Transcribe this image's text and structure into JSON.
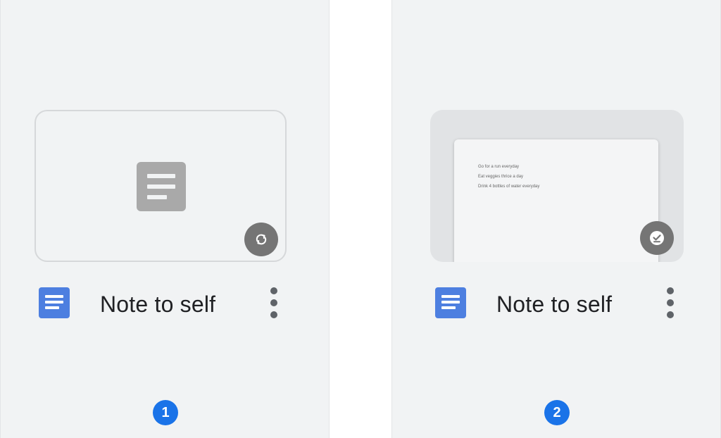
{
  "colors": {
    "panel_background": "#f1f3f4",
    "doc_icon_blue": "#4d7fe0",
    "status_badge_gray": "#757575",
    "step_marker_blue": "#1a73e8",
    "title_text": "#202124"
  },
  "panels": [
    {
      "thumbnail": {
        "state": "not-downloaded",
        "placeholder_icon": "document-placeholder-icon",
        "status_icon": "sync-icon"
      },
      "file": {
        "type_icon": "google-docs-icon",
        "title": "Note to self",
        "menu_icon": "more-vert-icon"
      },
      "step": "1"
    },
    {
      "thumbnail": {
        "state": "available-offline",
        "preview_lines": [
          "Go for a run everyday",
          "Eat veggies thrice a day",
          "Drink 4 bottles of water everyday"
        ],
        "status_icon": "offline-check-icon"
      },
      "file": {
        "type_icon": "google-docs-icon",
        "title": "Note to self",
        "menu_icon": "more-vert-icon"
      },
      "step": "2"
    }
  ]
}
